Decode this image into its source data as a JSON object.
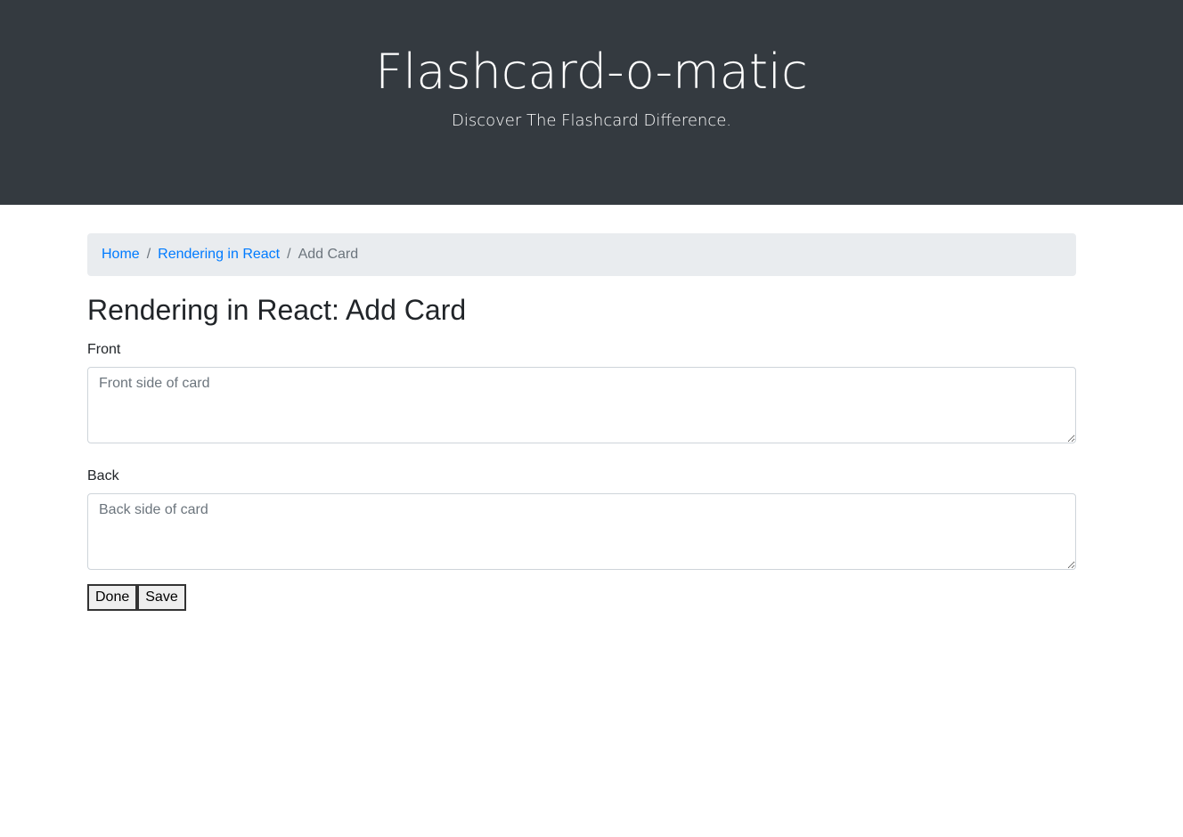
{
  "header": {
    "title": "Flashcard-o-matic",
    "subtitle": "Discover The Flashcard Difference."
  },
  "breadcrumb": {
    "home": "Home",
    "deck": "Rendering in React",
    "current": "Add Card",
    "separator": "/"
  },
  "page": {
    "title": "Rendering in React: Add Card"
  },
  "form": {
    "front_label": "Front",
    "front_placeholder": "Front side of card",
    "front_value": "",
    "back_label": "Back",
    "back_placeholder": "Back side of card",
    "back_value": "",
    "done_label": "Done",
    "save_label": "Save"
  },
  "colors": {
    "header_bg": "#343a40",
    "link": "#007bff",
    "breadcrumb_bg": "#e9ecef"
  }
}
